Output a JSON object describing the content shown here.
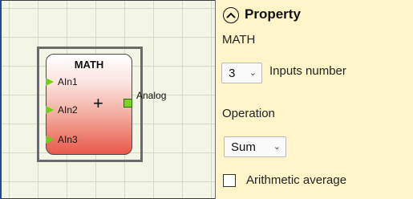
{
  "canvas": {
    "block": {
      "title": "MATH",
      "operator_symbol": "+",
      "inputs": [
        "AIn1",
        "AIn2",
        "AIn3"
      ],
      "output_label": "Analog",
      "colors": {
        "pin_green": "#6fd10f",
        "body_bottom": "#e9584a"
      }
    }
  },
  "panel": {
    "title": "Property",
    "collapse_icon": "chevron-up-circle-icon",
    "component_name": "MATH",
    "inputs_number": {
      "value": "3",
      "label": "Inputs number"
    },
    "operation": {
      "label": "Operation",
      "value": "Sum"
    },
    "arithmetic_average": {
      "label": "Arithmetic average",
      "checked": false
    },
    "colors": {
      "background": "#fff5c9"
    }
  }
}
